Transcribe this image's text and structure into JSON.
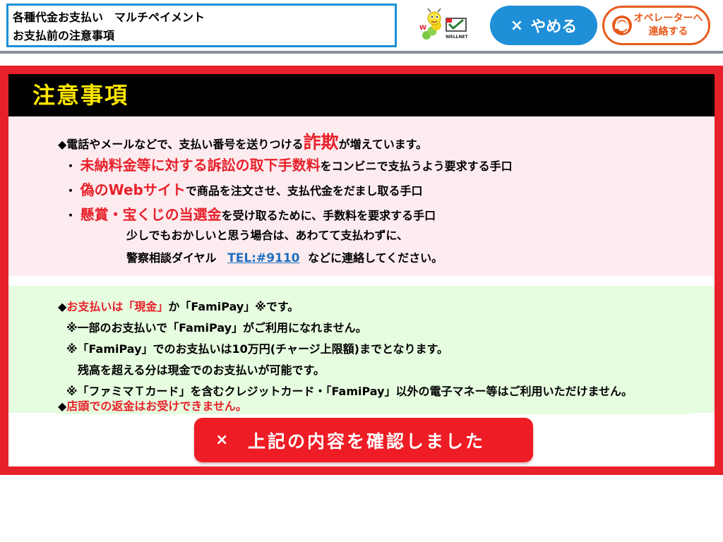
{
  "header": {
    "title_line1": "各種代金お支払い　マルチペイメント",
    "title_line2": "お支払前の注意事項",
    "logo_text": "WELLNET",
    "stop_x": "×",
    "stop_label": "やめる",
    "operator_label_line1": "オペレーターへ",
    "operator_label_line2": "連絡する"
  },
  "notice": {
    "heading": "注意事項",
    "fraud": {
      "intro_pre": "◆電話やメールなどで、支払い番号を送りつける",
      "intro_em": "詐欺",
      "intro_post": "が増えています。",
      "item1_bullet": "・",
      "item1_em": "未納料金等に対する訴訟の取下手数料",
      "item1_post": "をコンビニで支払うよう要求する手口",
      "item2_bullet": "・",
      "item2_em": "偽のWebサイト",
      "item2_post": "で商品を注文させ、支払代金をだまし取る手口",
      "item3_bullet": "・",
      "item3_em": "懸賞・宝くじの当選金",
      "item3_post": "を受け取るために、手数料を要求する手口",
      "advice1": "少しでもおかしいと思う場合は、あわてて支払わずに、",
      "advice2_pre": "警察相談ダイヤル",
      "tel": "TEL:#9110",
      "advice2_post": "などに連絡してください。"
    },
    "payment": {
      "line1_mark": "◆",
      "line1_red": "お支払いは「現金」",
      "line1_post": "か「FamiPay」※です。",
      "line2": "※一部のお支払いで「FamiPay」がご利用になれません。",
      "line3": "※「FamiPay」でのお支払いは10万円(チャージ上限額)までとなります。",
      "line4": "残高を超える分は現金でのお支払いが可能です。",
      "line5": "※「ファミマＴカード」を含むクレジットカード・「FamiPay」以外の電子マネー等はご利用いただけません。",
      "line6_mark": "◆",
      "line6_red": "店頭での返金はお受けできません。"
    },
    "confirm_x": "×",
    "confirm_label": "上記の内容を確認しました"
  },
  "colors": {
    "accent_blue": "#1f8fd8",
    "operator_orange": "#e85a1b",
    "alert_red": "#e8202a",
    "heading_yellow": "#ffe600",
    "pink_bg": "#fdecef",
    "green_bg": "#e6fde0"
  },
  "icons": [
    "mascot-logo-icon",
    "operator-headset-icon",
    "close-x-icon"
  ]
}
